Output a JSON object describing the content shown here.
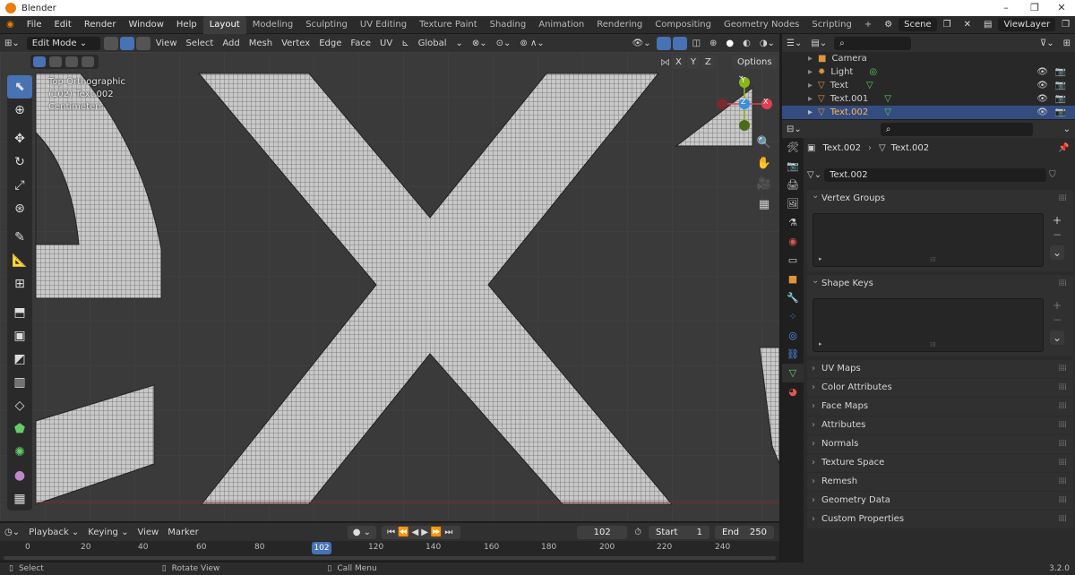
{
  "window": {
    "title": "Blender"
  },
  "menu": [
    "File",
    "Edit",
    "Render",
    "Window",
    "Help"
  ],
  "workspaces": [
    "Layout",
    "Modeling",
    "Sculpting",
    "UV Editing",
    "Texture Paint",
    "Shading",
    "Animation",
    "Rendering",
    "Compositing",
    "Geometry Nodes",
    "Scripting"
  ],
  "scene": {
    "name": "Scene",
    "view_layer": "ViewLayer"
  },
  "viewport_header": {
    "mode": "Edit Mode",
    "menus": [
      "View",
      "Select",
      "Add",
      "Mesh",
      "Vertex",
      "Edge",
      "Face",
      "UV"
    ],
    "transform": "Global",
    "options": "Options",
    "axes": [
      "X",
      "Y",
      "Z"
    ]
  },
  "viewport_overlay": {
    "view": "Top Orthographic",
    "object": "(102) Text.002",
    "units": "Centimeters"
  },
  "gizmo": {
    "y": "Y",
    "z": "Z",
    "x": "X"
  },
  "outliner": {
    "rows": [
      {
        "name": "Camera",
        "icon": "camera-icon",
        "color": "#e0953a"
      },
      {
        "name": "Light",
        "icon": "light-icon",
        "color": "#e0953a"
      },
      {
        "name": "Text",
        "icon": "text-object-icon",
        "color": "#e0953a"
      },
      {
        "name": "Text.001",
        "icon": "text-object-icon",
        "color": "#e0953a"
      },
      {
        "name": "Text.002",
        "icon": "text-object-icon",
        "color": "#e0953a",
        "selected": true
      }
    ]
  },
  "properties": {
    "breadcrumb": {
      "object": "Text.002",
      "data": "Text.002"
    },
    "datablock": "Text.002",
    "panels_open": [
      "Vertex Groups",
      "Shape Keys"
    ],
    "panels_closed": [
      "UV Maps",
      "Color Attributes",
      "Face Maps",
      "Attributes",
      "Normals",
      "Texture Space",
      "Remesh",
      "Geometry Data",
      "Custom Properties"
    ]
  },
  "timeline": {
    "menus": [
      "Playback",
      "Keying",
      "View",
      "Marker"
    ],
    "current_frame": "102",
    "start_label": "Start",
    "start": "1",
    "end_label": "End",
    "end": "250",
    "ticks": [
      "0",
      "20",
      "40",
      "60",
      "80",
      "120",
      "140",
      "160",
      "180",
      "200",
      "220",
      "240"
    ]
  },
  "status": {
    "select": "Select",
    "rotate": "Rotate View",
    "menu": "Call Menu",
    "version": "3.2.0"
  },
  "colors": {
    "accent": "#4772b3",
    "selection": "#334d80",
    "mesh": "#c8c8c8",
    "axis_x": "#e0404f",
    "axis_y": "#8ab51c",
    "axis_z": "#3b8ee0"
  }
}
